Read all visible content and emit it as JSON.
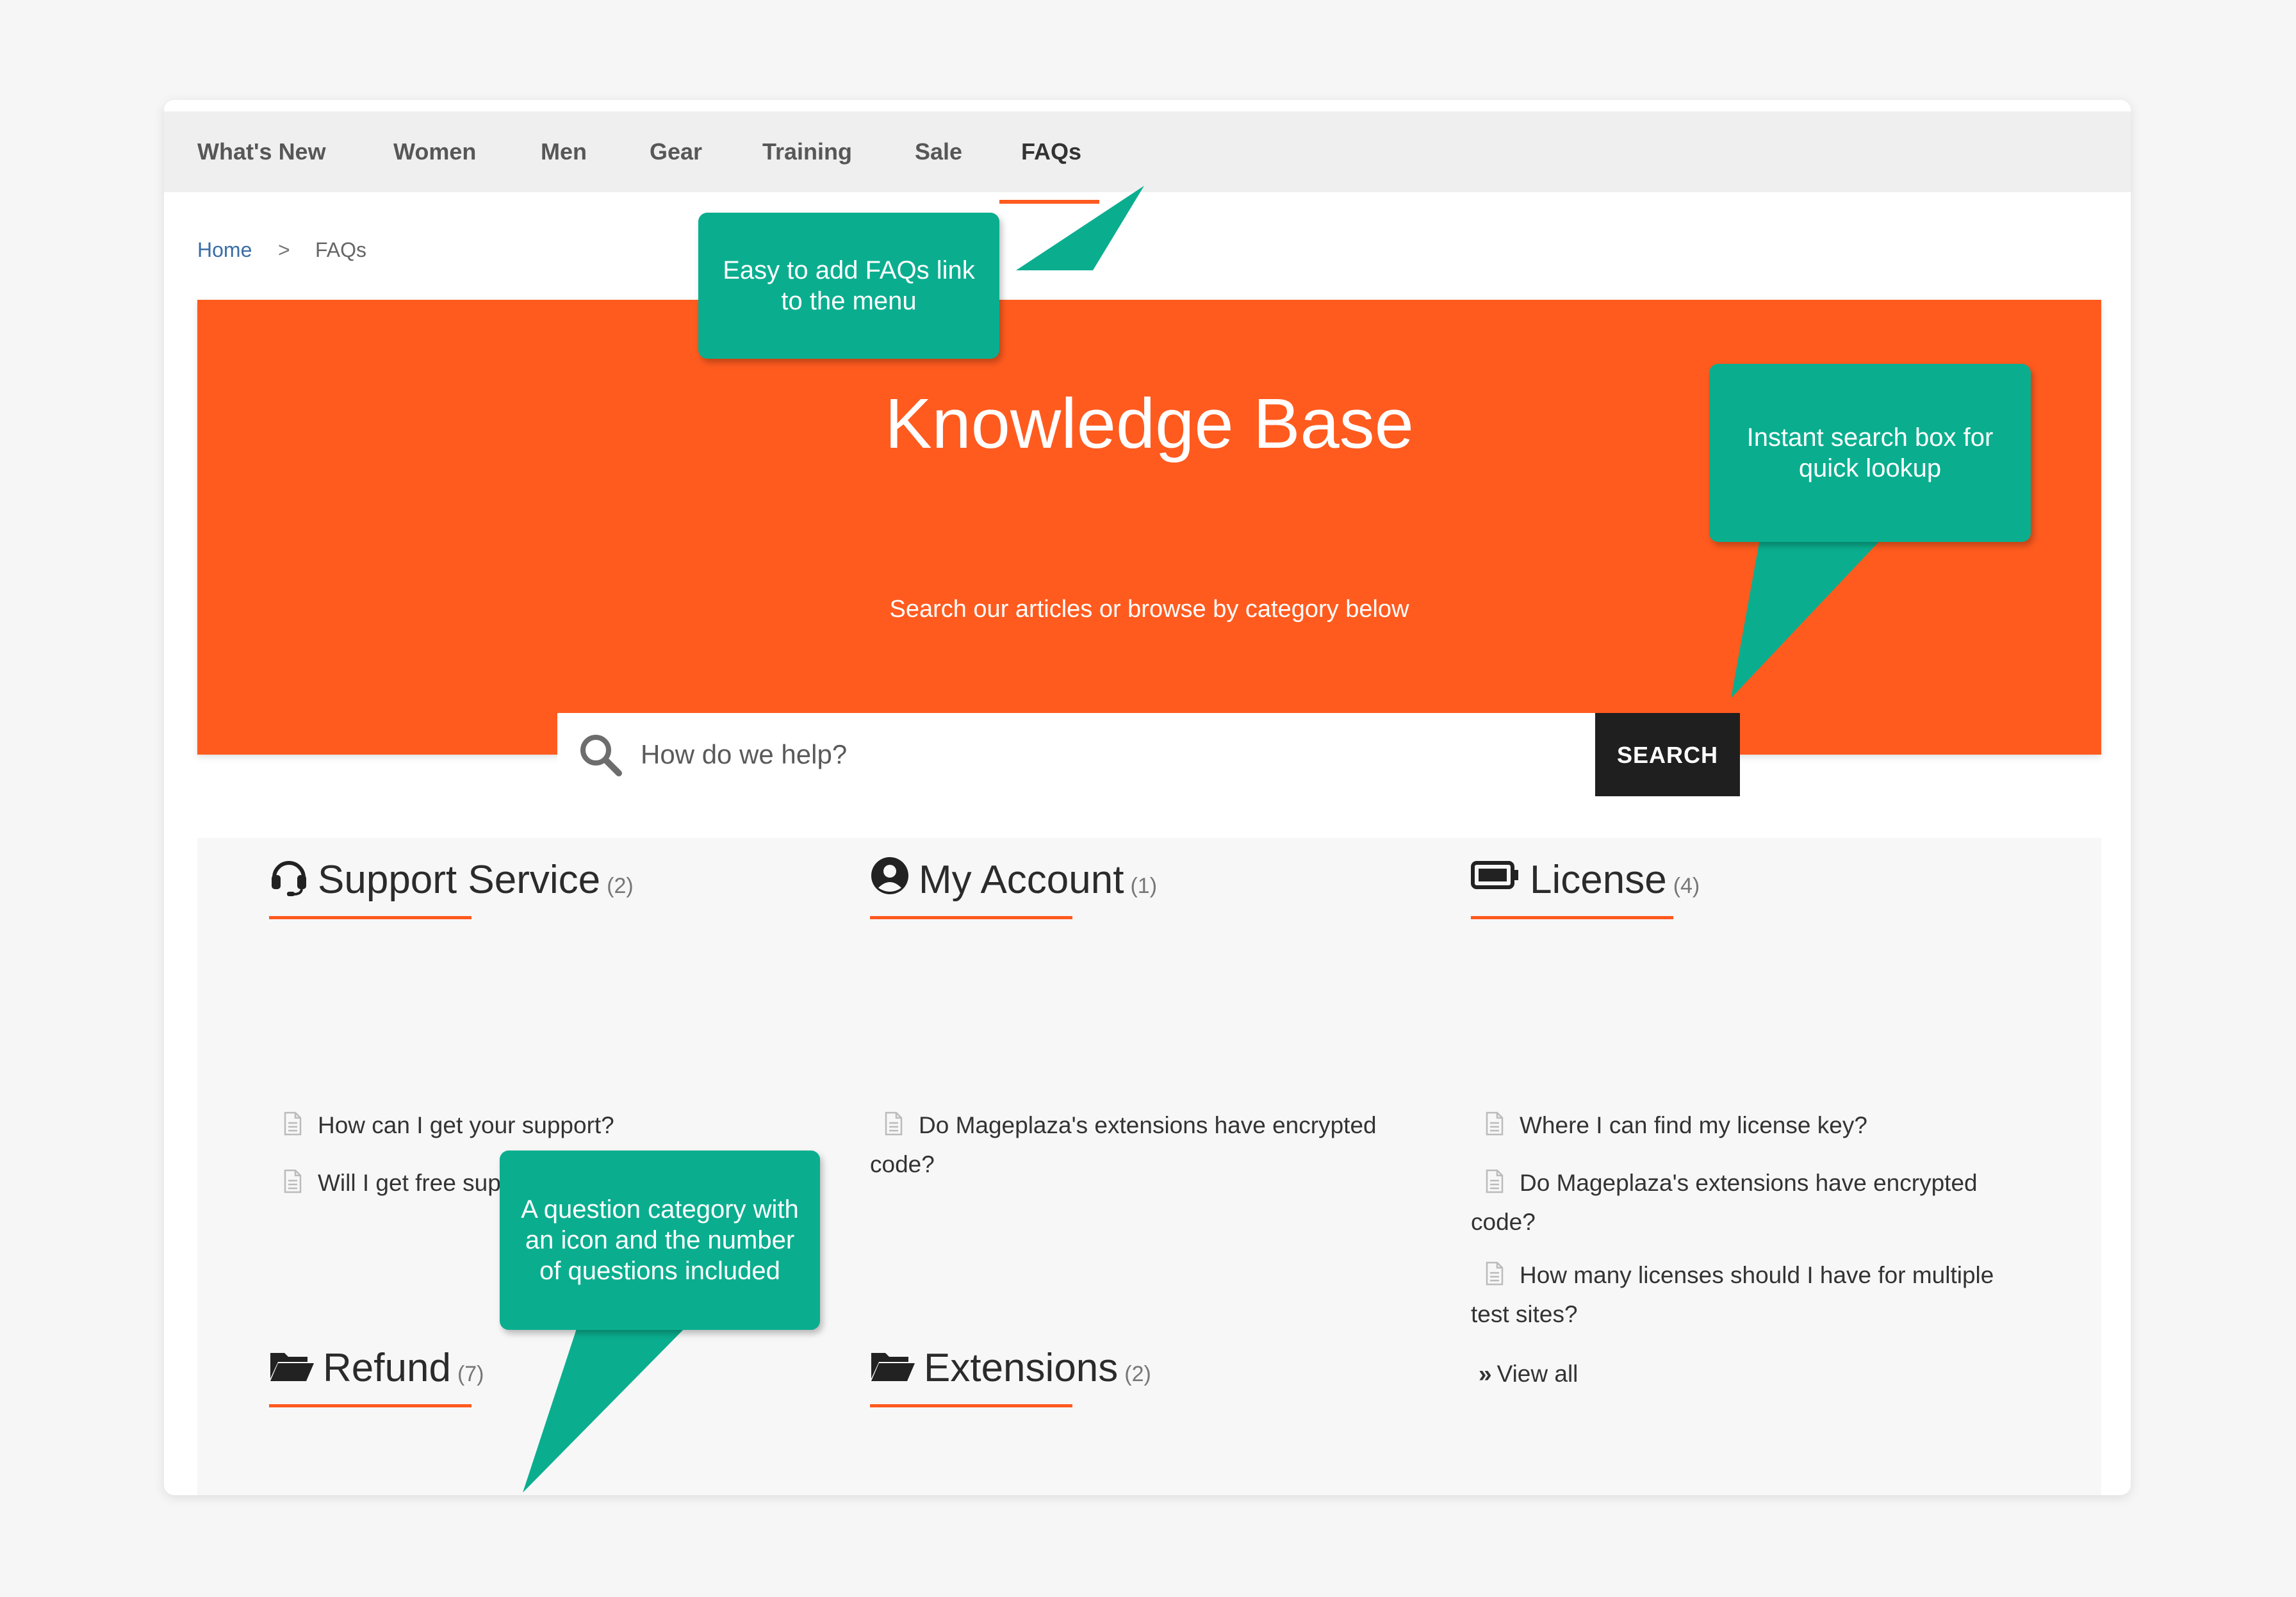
{
  "nav": {
    "items": [
      {
        "label": "What's New"
      },
      {
        "label": "Women"
      },
      {
        "label": "Men"
      },
      {
        "label": "Gear"
      },
      {
        "label": "Training"
      },
      {
        "label": "Sale"
      },
      {
        "label": "FAQs",
        "active": true
      }
    ]
  },
  "breadcrumb": {
    "home": "Home",
    "separator": ">",
    "current": "FAQs"
  },
  "hero": {
    "title": "Knowledge Base",
    "subtitle": "Search our articles or browse by category below",
    "search_placeholder": "How do we help?",
    "search_button": "SEARCH"
  },
  "categories": [
    {
      "title": "Support Service",
      "count": "(2)",
      "icon": "headset-icon",
      "questions": [
        "How can I get your support?",
        "Will I get free support and updates?"
      ]
    },
    {
      "title": "My Account",
      "count": "(1)",
      "icon": "user-circle-icon",
      "questions": [
        "Do Mageplaza's extensions have encrypted code?"
      ]
    },
    {
      "title": "License",
      "count": "(4)",
      "icon": "battery-icon",
      "questions": [
        "Where I can find my license key?",
        "Do Mageplaza's extensions have encrypted code?",
        "How many licenses should I have for multiple test sites?"
      ],
      "view_all": "View all"
    },
    {
      "title": "Refund",
      "count": "(7)",
      "icon": "folder-open-icon",
      "questions": []
    },
    {
      "title": "Extensions",
      "count": "(2)",
      "icon": "folder-open-icon",
      "questions": []
    }
  ],
  "tooltips": {
    "menu": "Easy to add FAQs link to the menu",
    "search": "Instant search box for quick lookup",
    "category": "A question category with an icon and the number of questions included"
  },
  "colors": {
    "accent": "#ff5b1f",
    "tooltip": "#0aae8f",
    "button_dark": "#1f1f1f",
    "nav_bg": "#efefef"
  }
}
